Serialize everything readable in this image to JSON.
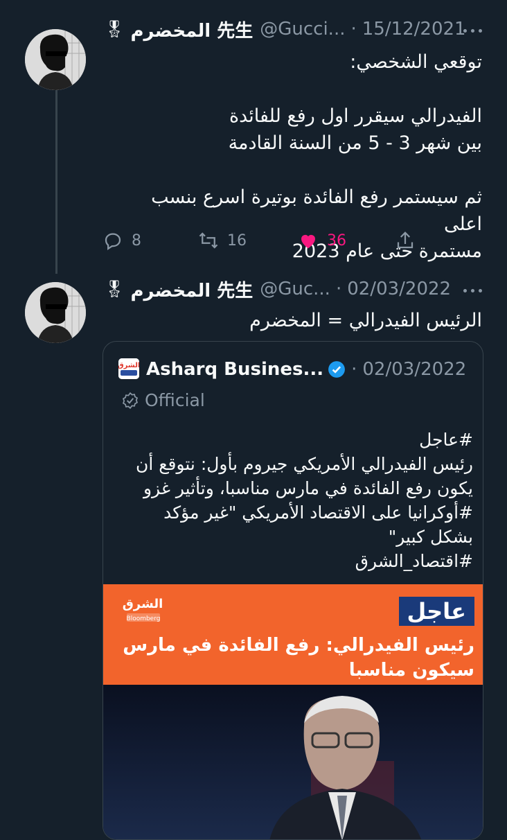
{
  "tweets": [
    {
      "name": "المخضرم 先生",
      "handle": "@Gucci...",
      "separator": "·",
      "date": "15/12/2021",
      "lines": [
        "توقعي الشخصي:",
        "",
        "الفيدرالي سيقرر اول رفع للفائدة",
        "بين شهر 3 - 5 من السنة القادمة",
        "",
        "ثم سيستمر رفع الفائدة بوتيرة اسرع بنسب اعلى",
        "مستمرة حتى عام 2023"
      ],
      "replies": "8",
      "retweets": "16",
      "likes": "36"
    },
    {
      "name": "المخضرم 先生",
      "handle": "@Guc...",
      "separator": "·",
      "date": "02/03/2022",
      "lines": [
        "الرئيس الفيدرالي = المخضرم"
      ]
    }
  ],
  "quote": {
    "name": "Asharq Busines...",
    "separator": "·",
    "date": "02/03/2022",
    "official_label": "Official",
    "lines": [
      "#عاجل",
      "رئيس الفيدرالي الأمريكي جيروم بأول: نتوقع أن",
      "يكون رفع الفائدة في مارس مناسبا، وتأثير غزو",
      "#أوكرانيا على الاقتصاد الأمريكي \"غير مؤكد",
      "بشكل كبير\"",
      "#اقتصاد_الشرق"
    ],
    "image": {
      "badge": "عاجل",
      "headline": "رئيس الفيدرالي: رفع الفائدة في مارس سيكون مناسبا",
      "logo_text": "الشرق",
      "logo_sub": "Bloomberg"
    }
  },
  "colors": {
    "background": "#15202b",
    "like": "#f91880",
    "verified": "#1d9bf0",
    "banner": "#f2642c"
  }
}
